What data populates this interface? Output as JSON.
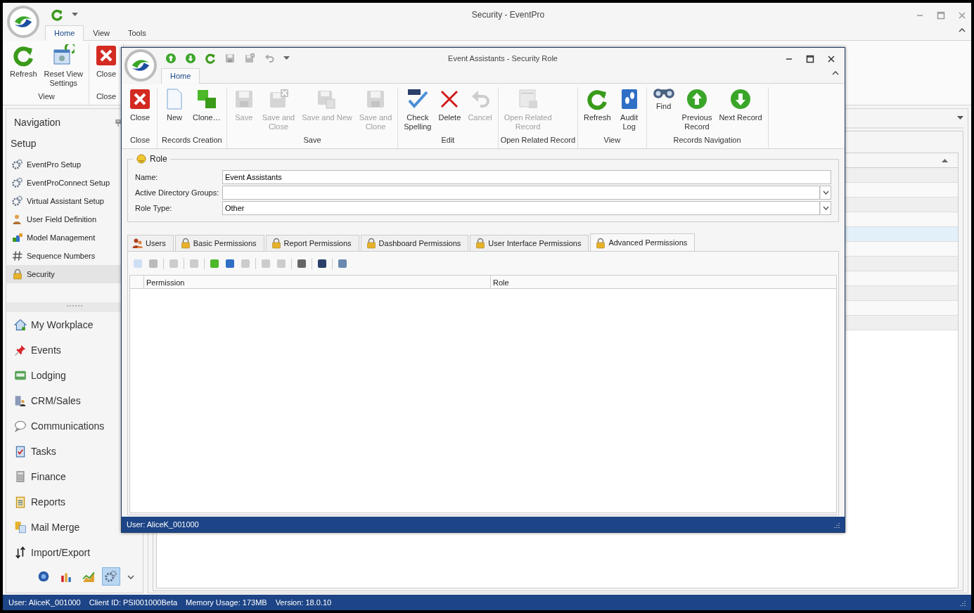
{
  "main_window": {
    "title": "Security - EventPro",
    "ribbon_tabs": [
      {
        "label": "Home",
        "selected": true
      },
      {
        "label": "View",
        "selected": false
      },
      {
        "label": "Tools",
        "selected": false
      }
    ],
    "ribbon_groups": [
      {
        "label": "View",
        "buttons": [
          {
            "label": "Refresh"
          },
          {
            "label": "Reset View\nSettings"
          }
        ]
      },
      {
        "label": "Close",
        "buttons": [
          {
            "label": "Close"
          }
        ]
      }
    ]
  },
  "navigation": {
    "title": "Navigation",
    "section": "Setup",
    "setup_items": [
      {
        "label": "EventPro Setup",
        "selected": false
      },
      {
        "label": "EventProConnect Setup",
        "selected": false
      },
      {
        "label": "Virtual Assistant Setup",
        "selected": false
      },
      {
        "label": "User Field Definition",
        "selected": false
      },
      {
        "label": "Model Management",
        "selected": false
      },
      {
        "label": "Sequence Numbers",
        "selected": false
      },
      {
        "label": "Security",
        "selected": true
      }
    ],
    "modules": [
      {
        "label": "My Workplace"
      },
      {
        "label": "Events"
      },
      {
        "label": "Lodging"
      },
      {
        "label": "CRM/Sales"
      },
      {
        "label": "Communications"
      },
      {
        "label": "Tasks"
      },
      {
        "label": "Finance"
      },
      {
        "label": "Reports"
      },
      {
        "label": "Mail Merge"
      },
      {
        "label": "Import/Export"
      }
    ],
    "shortcuts": [
      {
        "selected": false
      },
      {
        "selected": false
      },
      {
        "selected": false
      },
      {
        "selected": true
      }
    ]
  },
  "background_grid": {
    "rows": [
      {
        "selected": false
      },
      {
        "selected": false
      },
      {
        "selected": false
      },
      {
        "selected": false
      },
      {
        "selected": true
      },
      {
        "selected": false
      },
      {
        "selected": false
      },
      {
        "selected": false
      },
      {
        "selected": false
      },
      {
        "selected": false
      },
      {
        "selected": false
      }
    ]
  },
  "dialog": {
    "title": "Event Assistants - Security Role",
    "ribbon_tabs": [
      {
        "label": "Home",
        "selected": true
      }
    ],
    "ribbon_groups": [
      {
        "label": "Close",
        "buttons": [
          {
            "label": "Close",
            "disabled": false
          }
        ]
      },
      {
        "label": "Records Creation",
        "buttons": [
          {
            "label": "New",
            "disabled": false
          },
          {
            "label": "Clone…",
            "disabled": false
          }
        ]
      },
      {
        "label": "Save",
        "buttons": [
          {
            "label": "Save",
            "disabled": true
          },
          {
            "label": "Save and\nClose",
            "disabled": true
          },
          {
            "label": "Save and New",
            "disabled": true
          },
          {
            "label": "Save and\nClone",
            "disabled": true
          }
        ]
      },
      {
        "label": "Edit",
        "buttons": [
          {
            "label": "Check\nSpelling",
            "disabled": false
          },
          {
            "label": "Delete",
            "disabled": false
          },
          {
            "label": "Cancel",
            "disabled": true
          }
        ]
      },
      {
        "label": "Open Related Record",
        "buttons": [
          {
            "label": "Open Related\nRecord",
            "disabled": true
          }
        ]
      },
      {
        "label": "View",
        "buttons": [
          {
            "label": "Refresh",
            "disabled": false
          },
          {
            "label": "Audit\nLog",
            "disabled": false
          }
        ]
      },
      {
        "label": "Records Navigation",
        "buttons": [
          {
            "label": "Find",
            "disabled": false
          },
          {
            "label": "Previous\nRecord",
            "disabled": false
          },
          {
            "label": "Next Record",
            "disabled": false
          }
        ]
      }
    ],
    "role": {
      "legend": "Role",
      "fields": [
        {
          "label": "Name:",
          "value": "Event Assistants",
          "kind": "text"
        },
        {
          "label": "Active Directory Groups:",
          "kind": "combo"
        },
        {
          "label": "Role Type:",
          "value": "Other",
          "kind": "combo"
        }
      ]
    },
    "tabs": [
      {
        "label": "Users",
        "selected": false
      },
      {
        "label": "Basic Permissions",
        "selected": false
      },
      {
        "label": "Report Permissions",
        "selected": false
      },
      {
        "label": "Dashboard Permissions",
        "selected": false
      },
      {
        "label": "User Interface Permissions",
        "selected": false
      },
      {
        "label": "Advanced Permissions",
        "selected": true
      }
    ],
    "grid": {
      "columns": [
        "Permission",
        "Role"
      ]
    },
    "status": "User: AliceK_001000"
  },
  "status_bar": [
    "User: AliceK_001000",
    "Client ID: PSI001000Beta",
    "Memory Usage: 173MB",
    "Version: 18.0.10"
  ]
}
